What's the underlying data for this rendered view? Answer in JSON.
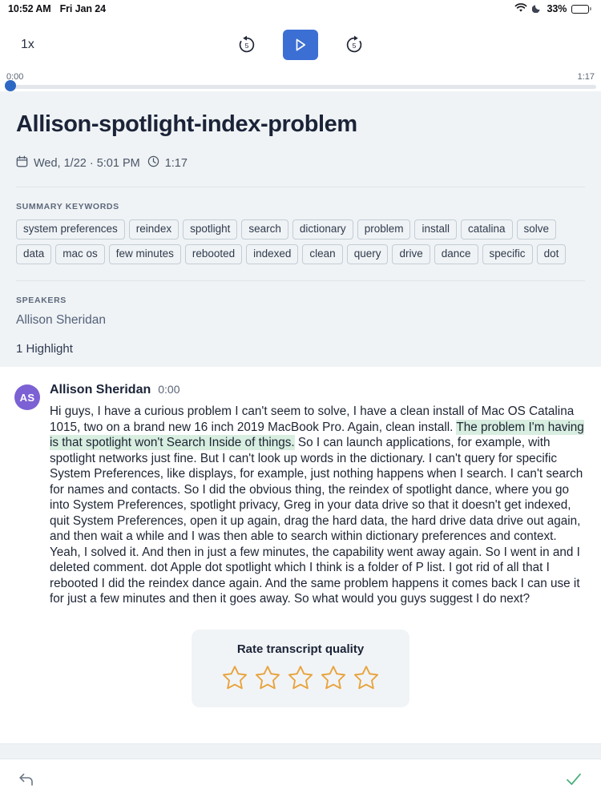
{
  "status_bar": {
    "time": "10:52 AM",
    "date": "Fri Jan 24",
    "battery_percent": "33%",
    "wifi_icon": "wifi-icon",
    "dnd_icon": "moon-icon",
    "battery_icon": "battery-icon"
  },
  "player": {
    "speed_label": "1x",
    "rewind_label": "5",
    "forward_label": "5",
    "play_icon": "play-icon",
    "rewind_icon": "rewind-5-icon",
    "forward_icon": "forward-5-icon",
    "current_time": "0:00",
    "total_time": "1:17",
    "progress_percent": 0,
    "accent_color": "#3b6fd4"
  },
  "header": {
    "title": "Allison-spotlight-index-problem",
    "date_label": "Wed, 1/22 · 5:01 PM",
    "duration_label": "1:17",
    "calendar_icon": "calendar-icon",
    "clock_icon": "clock-icon",
    "keywords_section_label": "SUMMARY KEYWORDS",
    "keywords": [
      "system preferences",
      "reindex",
      "spotlight",
      "search",
      "dictionary",
      "problem",
      "install",
      "catalina",
      "solve",
      "data",
      "mac os",
      "few minutes",
      "rebooted",
      "indexed",
      "clean",
      "query",
      "drive",
      "dance",
      "specific",
      "dot"
    ],
    "speakers_section_label": "SPEAKERS",
    "speakers": "Allison Sheridan",
    "highlight_count_label": "1 Highlight"
  },
  "transcript": {
    "avatar_initials": "AS",
    "speaker": "Allison Sheridan",
    "timestamp": "0:00",
    "text_before": "Hi guys, I have a curious problem I can't seem to solve, I have a clean install of Mac OS Catalina 1015, two on a brand new 16 inch 2019 MacBook Pro. Again, clean install. ",
    "text_highlighted": "The problem I'm having is that spotlight won't Search Inside of things.",
    "text_after": " So I can launch applications, for example, with spotlight networks just fine. But I can't look up words in the dictionary. I can't query for specific System Preferences, like displays, for example, just nothing happens when I search. I can't search for names and contacts. So I did the obvious thing, the reindex of spotlight dance, where you go into System Preferences, spotlight privacy, Greg in your data drive so that it doesn't get indexed, quit System Preferences, open it up again, drag the hard data, the hard drive data drive out again, and then wait a while and I was then able to search within dictionary preferences and context. Yeah, I solved it. And then in just a few minutes, the capability went away again. So I went in and I deleted comment. dot Apple dot spotlight which I think is a folder of P list. I got rid of all that I rebooted I did the reindex dance again. And the same problem happens it comes back I can use it for just a few minutes and then it goes away. So what would you guys suggest I do next?",
    "highlight_color": "#d8eee0",
    "avatar_color": "#7b61d3"
  },
  "rating": {
    "title": "Rate transcript quality",
    "star_count": 5,
    "filled_count": 0,
    "star_icon": "star-outline-icon",
    "star_color": "#e8a33d"
  },
  "bottom_bar": {
    "back_icon": "undo-arrow-icon",
    "confirm_icon": "checkmark-icon",
    "confirm_color": "#4caf7d"
  }
}
